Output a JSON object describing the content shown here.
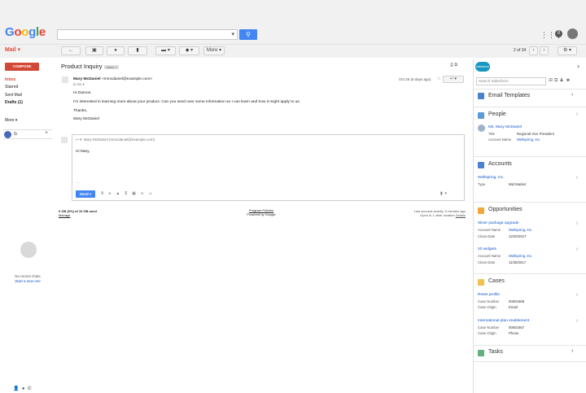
{
  "header": {
    "logo": "Google",
    "logo_colors": [
      "#4285f4",
      "#ea4335",
      "#fbbc05",
      "#4285f4",
      "#34a853",
      "#ea4335"
    ]
  },
  "toolbar": {
    "mail_label": "Mail",
    "more_label": "More",
    "pager_text": "2 of 34"
  },
  "sidebar": {
    "compose_label": "COMPOSE",
    "items": [
      {
        "label": "Inbox",
        "active": true
      },
      {
        "label": "Starred",
        "active": false
      },
      {
        "label": "Sent Mail",
        "active": false
      },
      {
        "label": "Drafts (1)",
        "active": false
      }
    ],
    "more_label": "More",
    "hangout_user": "G",
    "no_chats": "No recent chats",
    "start_chat": "Start a new one"
  },
  "email": {
    "subject": "Product Inquiry",
    "tag": "Inbox",
    "sender_name": "Mary McDaniel",
    "sender_email": "<mmcdaniel@example.com>",
    "to": "to me",
    "date": "Oct 25 (9 days ago)",
    "body": [
      "Hi Damon,",
      "I'm interested in learning more about your product. Can you send over some information so I can learn and how it might apply to us.",
      "Thanks,",
      "Mary McDaniel"
    ],
    "reply_to": "Mary McDaniel (mmcdaniel@example.com)",
    "reply_text": "Hi Mary,",
    "send_label": "Send"
  },
  "footer": {
    "storage": "0 GB (0%) of 15 GB used",
    "manage": "Manage",
    "policies": "Program Policies",
    "powered": "Powered by Google",
    "activity": "Last account activity: 0 minutes ago",
    "open_in": "Open in 1 other location",
    "details": "Details"
  },
  "salesforce": {
    "logo_text": "salesforce",
    "search_placeholder": "Search Salesforce",
    "email_templates": "Email Templates",
    "people": {
      "title": "People",
      "name": "Ms. Mary McDaniel",
      "title_label": "Title",
      "title_value": "Regional Vice President",
      "account_label": "Account Name",
      "account_value": "Wellspring, Inc."
    },
    "accounts": {
      "title": "Accounts",
      "name": "Wellspring, Inc.",
      "type_label": "Type",
      "type_value": "Mid Market"
    },
    "opportunities": {
      "title": "Opportunities",
      "records": [
        {
          "name": "Silver package upgrade",
          "account_label": "Account Name",
          "account": "Wellspring, Inc.",
          "date_label": "Close Date",
          "date": "12/20/2017"
        },
        {
          "name": "20 widgets",
          "account_label": "Account Name",
          "account": "Wellspring, Inc.",
          "date_label": "Close Date",
          "date": "11/30/2017"
        }
      ]
    },
    "cases": {
      "title": "Cases",
      "records": [
        {
          "name": "Reset profile",
          "num_label": "Case Number",
          "num": "00001868",
          "origin_label": "Case Origin",
          "origin": "Email"
        },
        {
          "name": "International plan enablement",
          "num_label": "Case Number",
          "num": "00001867",
          "origin_label": "Case Origin",
          "origin": "Phone"
        }
      ]
    },
    "tasks": "Tasks",
    "colors": {
      "people": "#5b9bd5",
      "accounts": "#4a7fd1",
      "opportunities": "#f0a83a",
      "cases": "#f0c14b",
      "tasks": "#5fb07c",
      "email_templates": "#4a7fd1"
    }
  }
}
